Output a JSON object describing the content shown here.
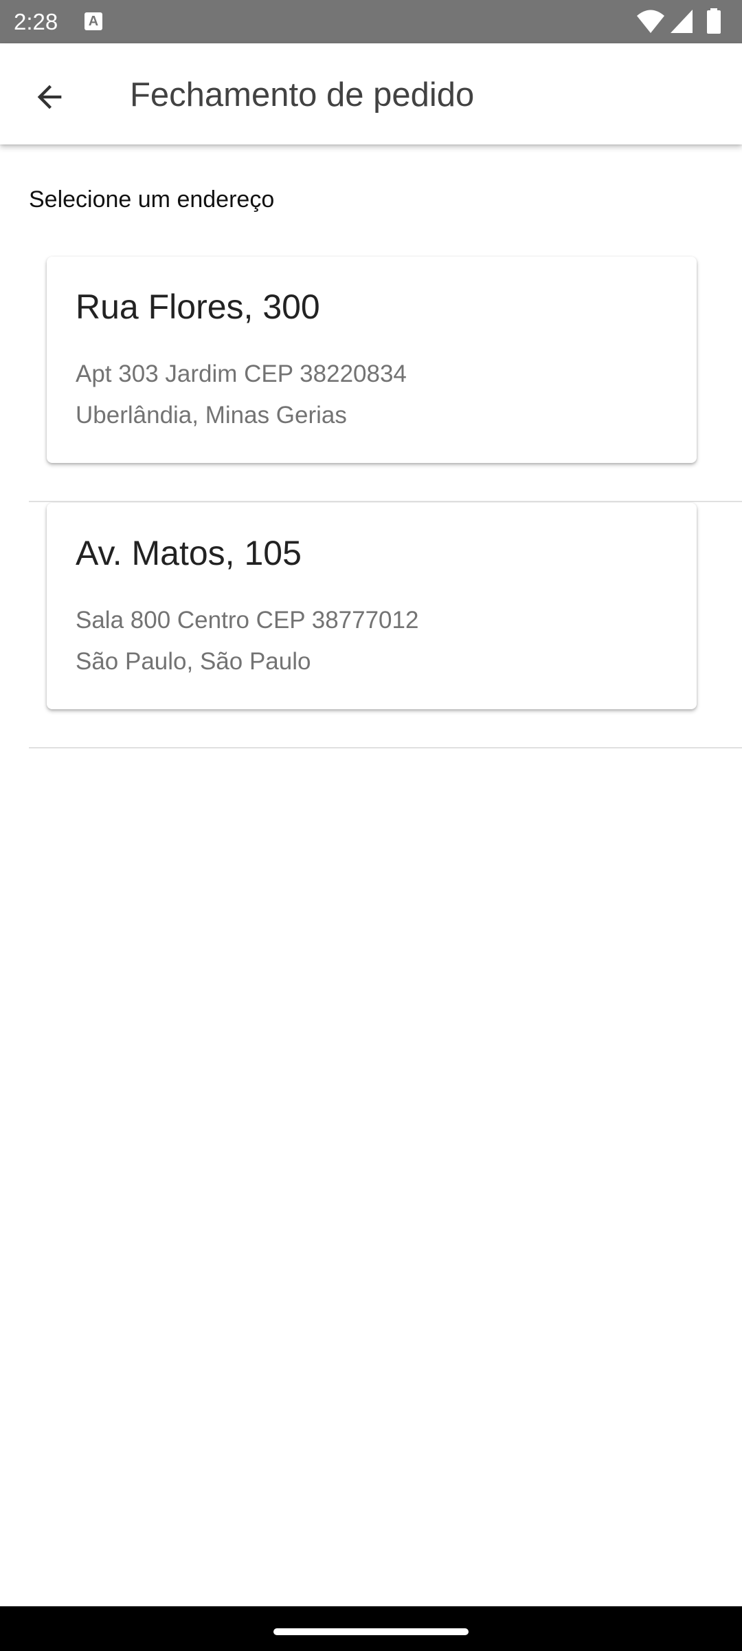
{
  "status_bar": {
    "time": "2:28",
    "notification_icon_letter": "A",
    "icons": [
      "wifi-icon",
      "signal-icon",
      "battery-icon"
    ]
  },
  "app_bar": {
    "title": "Fechamento de pedido",
    "back_icon": "arrow-back-icon"
  },
  "section": {
    "label": "Selecione um endereço"
  },
  "addresses": [
    {
      "title": "Rua Flores, 300",
      "line1": "Apt 303 Jardim CEP 38220834",
      "line2": "Uberlândia, Minas Gerias"
    },
    {
      "title": "Av. Matos, 105",
      "line1": "Sala 800 Centro CEP 38777012",
      "line2": "São Paulo, São Paulo"
    }
  ],
  "colors": {
    "status_bar": "#757575",
    "title_text": "#424242",
    "secondary_text": "#737373",
    "divider": "#e0e0e0"
  }
}
